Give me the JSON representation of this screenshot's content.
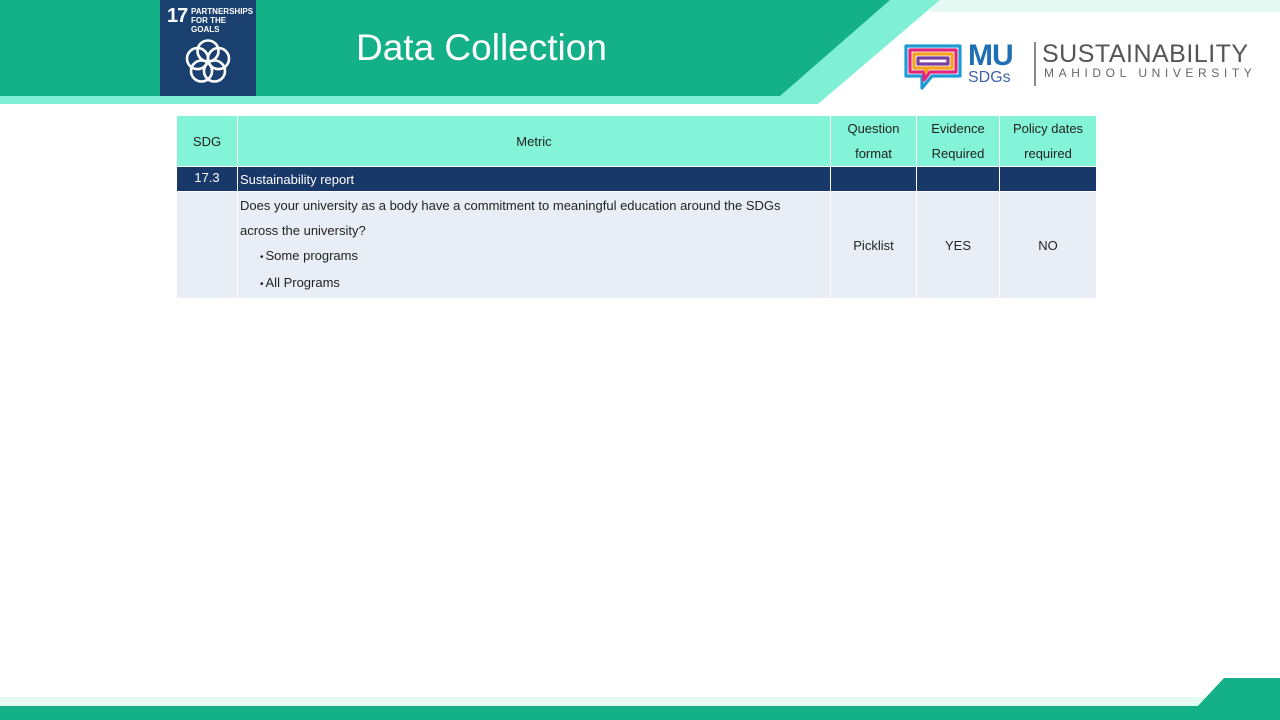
{
  "header": {
    "title": "Data Collection",
    "colors": {
      "dark": "#14b088",
      "light": "#7ff0d6",
      "badge": "#19406e"
    }
  },
  "sdg_badge": {
    "number": "17",
    "label_line1": "PARTNERSHIPS",
    "label_line2": "FOR THE GOALS",
    "icon": "partnership-rings-icon"
  },
  "logo": {
    "mu": "MU",
    "sdgs": "SDGs",
    "sustainability": "SUSTAINABILITY",
    "university": "MAHIDOL UNIVERSITY",
    "icon": "speech-bubble-logo-icon"
  },
  "table": {
    "headers": {
      "sdg": "SDG",
      "metric": "Metric",
      "question_format_1": "Question",
      "question_format_2": "format",
      "evidence_1": "Evidence",
      "evidence_2": "Required",
      "policy_1": "Policy dates",
      "policy_2": "required"
    },
    "section": {
      "sdg": "17.3",
      "metric": "Sustainability report"
    },
    "row": {
      "sdg": "",
      "question_line1": "Does your university as a body have a commitment to meaningful education around the SDGs",
      "question_line2": "across the university?",
      "options": [
        "Some programs",
        "All Programs"
      ],
      "bullet": "•",
      "question_format": "Picklist",
      "evidence_required": "YES",
      "policy_dates_required": "NO"
    }
  }
}
